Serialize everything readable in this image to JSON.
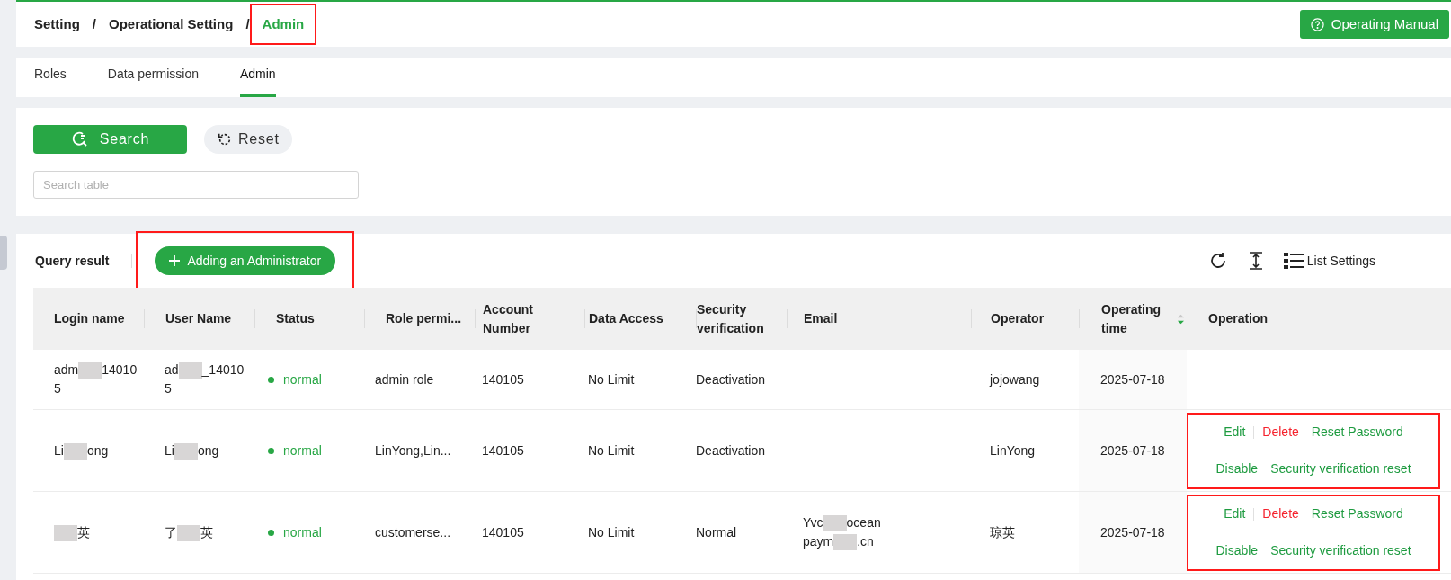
{
  "breadcrumb": [
    {
      "label": "Setting",
      "current": false,
      "highlighted": false
    },
    {
      "label": "Operational Setting",
      "current": false,
      "highlighted": false
    },
    {
      "label": "Admin",
      "current": true,
      "highlighted": true
    }
  ],
  "separator": "/",
  "manual_button": "Operating Manual",
  "tabs": [
    {
      "label": "Roles",
      "selected": false
    },
    {
      "label": "Data permission",
      "selected": false
    },
    {
      "label": "Admin",
      "selected": true
    }
  ],
  "search_button": "Search",
  "reset_button": "Reset",
  "search_field": {
    "placeholder": "Search table"
  },
  "result_title": "Query result",
  "add_button": {
    "label": "Adding an Administrator",
    "highlighted": true
  },
  "list_settings": "List Settings",
  "table": {
    "columns": [
      {
        "label": "Login name",
        "sortable": false
      },
      {
        "label": "User Name",
        "sortable": false
      },
      {
        "label": "Status",
        "sortable": false
      },
      {
        "label": "Role permi...",
        "sortable": false
      },
      {
        "label": "Account Number",
        "sortable": false
      },
      {
        "label": "Data Access",
        "sortable": false
      },
      {
        "label": "Security verification",
        "sortable": false
      },
      {
        "label": "Email",
        "sortable": false
      },
      {
        "label": "Operator",
        "sortable": false
      },
      {
        "label": "Operating time",
        "sortable": true
      },
      {
        "label": "Operation",
        "sortable": false
      }
    ],
    "rows": [
      {
        "login": [
          {
            "kind": "text",
            "text": "adm"
          },
          {
            "kind": "blur"
          },
          {
            "kind": "text",
            "text": "14010"
          },
          {
            "kind": "break"
          },
          {
            "kind": "text",
            "text": "5"
          }
        ],
        "user": [
          {
            "kind": "text",
            "text": "ad"
          },
          {
            "kind": "blur"
          },
          {
            "kind": "text",
            "text": "_14010"
          },
          {
            "kind": "break"
          },
          {
            "kind": "text",
            "text": "5"
          }
        ],
        "status": {
          "label": "normal",
          "color": "#28a745"
        },
        "role": "admin role",
        "account": "140105",
        "data_access": "No Limit",
        "security": "Deactivation",
        "email": [],
        "operator": "jojowang",
        "time": "2025-07-18",
        "actions": [],
        "highlighted": false
      },
      {
        "login": [
          {
            "kind": "text",
            "text": "Li"
          },
          {
            "kind": "blur"
          },
          {
            "kind": "text",
            "text": "ong"
          }
        ],
        "user": [
          {
            "kind": "text",
            "text": "Li"
          },
          {
            "kind": "blur"
          },
          {
            "kind": "text",
            "text": "ong"
          }
        ],
        "status": {
          "label": "normal",
          "color": "#28a745"
        },
        "role": "LinYong,Lin...",
        "account": "140105",
        "data_access": "No Limit",
        "security": "Deactivation",
        "email": [],
        "operator": "LinYong",
        "time": "2025-07-18",
        "actions": [
          {
            "label": "Edit",
            "kind": "normal"
          },
          {
            "label": "Delete",
            "kind": "danger"
          },
          {
            "label": "Reset Password",
            "kind": "normal"
          },
          {
            "label": "Disable",
            "kind": "normal"
          },
          {
            "label": "Security verification reset",
            "kind": "normal"
          }
        ],
        "highlighted": true
      },
      {
        "login": [
          {
            "kind": "blur"
          },
          {
            "kind": "text",
            "text": "英"
          }
        ],
        "user": [
          {
            "kind": "text",
            "text": "了"
          },
          {
            "kind": "blur"
          },
          {
            "kind": "text",
            "text": "英"
          }
        ],
        "status": {
          "label": "normal",
          "color": "#28a745"
        },
        "role": "customerse...",
        "account": "140105",
        "data_access": "No Limit",
        "security": "Normal",
        "email": [
          {
            "kind": "text",
            "text": "Yvc"
          },
          {
            "kind": "blur"
          },
          {
            "kind": "text",
            "text": "ocean"
          },
          {
            "kind": "break"
          },
          {
            "kind": "text",
            "text": "paym"
          },
          {
            "kind": "blur"
          },
          {
            "kind": "text",
            "text": ".cn"
          }
        ],
        "operator": "琼英",
        "time": "2025-07-18",
        "actions": [
          {
            "label": "Edit",
            "kind": "normal"
          },
          {
            "label": "Delete",
            "kind": "danger"
          },
          {
            "label": "Reset Password",
            "kind": "normal"
          },
          {
            "label": "Disable",
            "kind": "normal"
          },
          {
            "label": "Security verification reset",
            "kind": "normal"
          }
        ],
        "highlighted": true
      }
    ]
  }
}
